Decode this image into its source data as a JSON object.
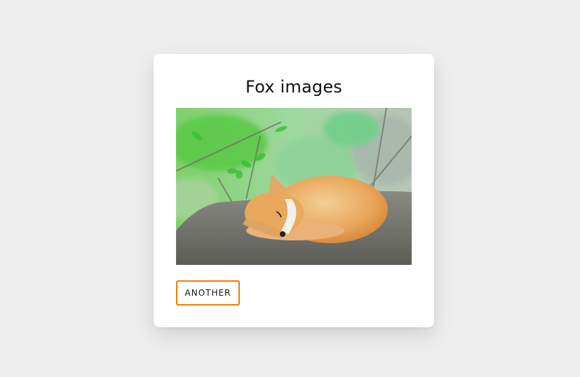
{
  "card": {
    "title": "Fox images",
    "image": {
      "alt": "Sleeping red fox curled up on a rock",
      "subject": "fox"
    },
    "button_label": "ANOTHER"
  },
  "colors": {
    "accent": "#f57c00",
    "background": "#eeeeee",
    "card": "#ffffff"
  }
}
